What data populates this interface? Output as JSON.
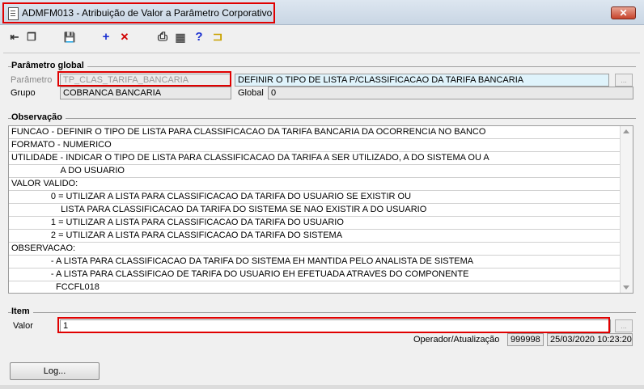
{
  "window": {
    "title": "ADMFM013 - Atribuição de Valor a Parâmetro Corporativo",
    "close_label": "✕"
  },
  "toolbar": [
    {
      "name": "first-record-icon",
      "glyph": "⇤"
    },
    {
      "name": "multi-window-icon",
      "glyph": "❐"
    },
    {
      "name": "save-icon",
      "glyph": "💾"
    },
    {
      "name": "add-icon",
      "glyph": "+"
    },
    {
      "name": "delete-icon",
      "glyph": "✕"
    },
    {
      "name": "print-icon",
      "glyph": "⎙"
    },
    {
      "name": "grid-icon",
      "glyph": "▦"
    },
    {
      "name": "help-icon",
      "glyph": "?"
    },
    {
      "name": "exit-door-icon",
      "glyph": "⊐"
    }
  ],
  "parametro_global": {
    "title": "Parâmetro global",
    "parametro_label": "Parâmetro",
    "parametro_value": "TP_CLAS_TARIFA_BANCARIA",
    "parametro_desc": "DEFINIR O TIPO DE LISTA P/CLASSIFICACAO DA TARIFA BANCARIA",
    "grupo_label": "Grupo",
    "grupo_value": "COBRANCA BANCARIA",
    "global_label": "Global",
    "global_value": "0",
    "lookup_label": "..."
  },
  "observacao": {
    "title": "Observação",
    "lines": [
      "FUNCAO - DEFINIR O TIPO DE LISTA PARA CLASSIFICACAO DA TARIFA BANCARIA DA OCORRENCIA NO BANCO",
      "FORMATO - NUMERICO",
      "UTILIDADE - INDICAR O TIPO DE LISTA PARA CLASSIFICACAO DA TARIFA A SER UTILIZADO, A DO SISTEMA OU A",
      "                    A DO USUARIO",
      "VALOR VALIDO:",
      "                0 = UTILIZAR A LISTA PARA CLASSIFICACAO DA TARIFA DO USUARIO SE EXISTIR OU",
      "                    LISTA PARA CLASSIFICACAO DA TARIFA DO SISTEMA SE NAO EXISTIR A DO USUARIO",
      "                1 = UTILIZAR A LISTA PARA CLASSIFICACAO DA TARIFA DO USUARIO",
      "                2 = UTILIZAR A LISTA PARA CLASSIFICACAO DA TARIFA DO SISTEMA",
      "OBSERVACAO:",
      "                - A LISTA PARA CLASSIFICACAO DA TARIFA DO SISTEMA EH MANTIDA PELO ANALISTA DE SISTEMA",
      "                - A LISTA PARA CLASSIFICAO DE TARIFA DO USUARIO EH EFETUADA ATRAVES DO COMPONENTE",
      "                  FCCFL018"
    ]
  },
  "item": {
    "title": "Item",
    "valor_label": "Valor",
    "valor_value": "1",
    "operador_label": "Operador/Atualização",
    "operador_value": "999998",
    "atualizacao_value": "25/03/2020 10:23:20"
  },
  "log_button": "Log..."
}
